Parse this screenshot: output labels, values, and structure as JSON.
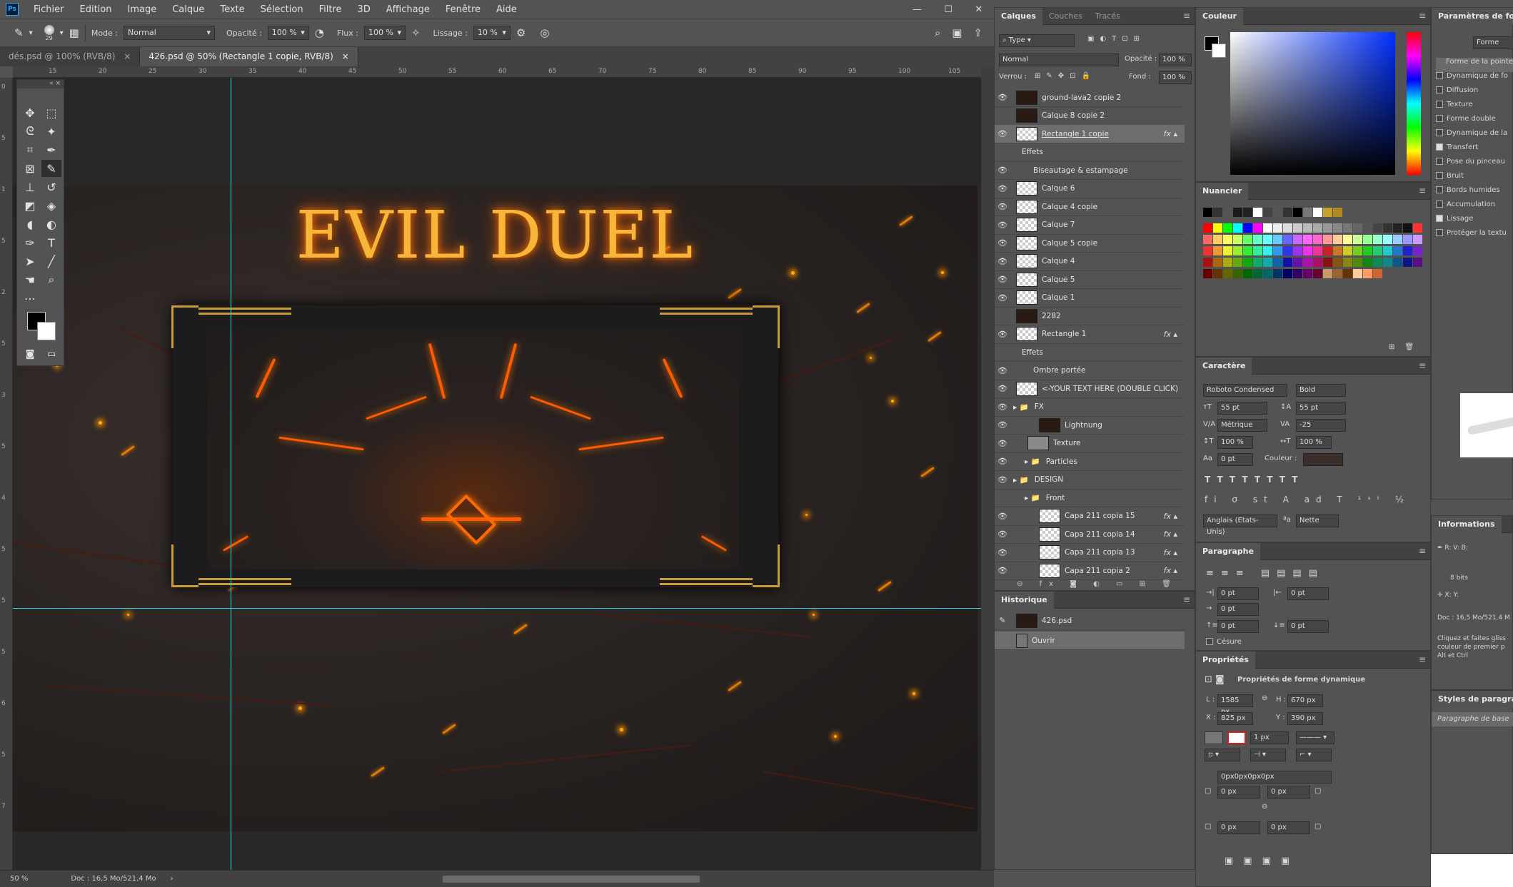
{
  "menu": [
    "Fichier",
    "Edition",
    "Image",
    "Calque",
    "Texte",
    "Sélection",
    "Filtre",
    "3D",
    "Affichage",
    "Fenêtre",
    "Aide"
  ],
  "options": {
    "brush_size": "29",
    "mode_label": "Mode :",
    "mode_value": "Normal",
    "opacity_label": "Opacité :",
    "opacity_value": "100 %",
    "flow_label": "Flux :",
    "flow_value": "100 %",
    "smoothing_label": "Lissage :",
    "smoothing_value": "10 %"
  },
  "doc_tabs": [
    {
      "label": "dés.psd @ 100% (RVB/8)",
      "active": false
    },
    {
      "label": "426.psd @ 50% (Rectangle 1 copie, RVB/8)",
      "active": true
    }
  ],
  "ruler_top": [
    "15",
    "20",
    "25",
    "30",
    "35",
    "40",
    "45",
    "50",
    "55",
    "60",
    "65",
    "70",
    "75",
    "80",
    "85",
    "90",
    "95",
    "100",
    "105"
  ],
  "ruler_left": [
    "0",
    "5",
    "1",
    "5",
    "2",
    "5",
    "3",
    "5",
    "4",
    "5",
    "5",
    "5",
    "6",
    "5",
    "7"
  ],
  "artwork": {
    "title": "EVIL DUEL"
  },
  "status": {
    "zoom": "50 %",
    "doc": "Doc : 16,5 Mo/521,4 Mo"
  },
  "layers_panel": {
    "tabs": [
      "Calques",
      "Couches",
      "Tracés"
    ],
    "filter": "Type",
    "blend": "Normal",
    "opacity_label": "Opacité :",
    "opacity_value": "100 %",
    "lock_label": "Verrou :",
    "fill_label": "Fond :",
    "fill_value": "100 %",
    "layers": [
      {
        "name": "ground-lava2 copie 2",
        "eye": true,
        "thumb": "dark",
        "fx": false,
        "indent": 0
      },
      {
        "name": "Calque 8 copie 2",
        "eye": false,
        "thumb": "dark",
        "fx": false,
        "indent": 0
      },
      {
        "name": "Rectangle 1 copie",
        "eye": true,
        "thumb": "shape",
        "fx": true,
        "indent": 0,
        "sel": true
      },
      {
        "name": "Effets",
        "eye": false,
        "thumb": "none",
        "fx": false,
        "indent": 1
      },
      {
        "name": "Biseautage & estampage",
        "eye": true,
        "thumb": "none",
        "fx": false,
        "indent": 2
      },
      {
        "name": "Calque 6",
        "eye": true,
        "thumb": "trans",
        "fx": false,
        "indent": 0
      },
      {
        "name": "Calque 4 copie",
        "eye": true,
        "thumb": "trans",
        "fx": false,
        "indent": 0
      },
      {
        "name": "Calque 7",
        "eye": true,
        "thumb": "trans",
        "fx": false,
        "indent": 0
      },
      {
        "name": "Calque 5 copie",
        "eye": true,
        "thumb": "trans",
        "fx": false,
        "indent": 0
      },
      {
        "name": "Calque 4",
        "eye": true,
        "thumb": "trans",
        "fx": false,
        "indent": 0
      },
      {
        "name": "Calque 5",
        "eye": true,
        "thumb": "trans",
        "fx": false,
        "indent": 0
      },
      {
        "name": "Calque 1",
        "eye": true,
        "thumb": "trans",
        "fx": false,
        "indent": 0
      },
      {
        "name": "2282",
        "eye": false,
        "thumb": "dark",
        "fx": false,
        "indent": 0
      },
      {
        "name": "Rectangle 1",
        "eye": true,
        "thumb": "shape",
        "fx": true,
        "indent": 0
      },
      {
        "name": "Effets",
        "eye": false,
        "thumb": "none",
        "fx": false,
        "indent": 1
      },
      {
        "name": "Ombre portée",
        "eye": true,
        "thumb": "none",
        "fx": false,
        "indent": 2
      },
      {
        "name": "<-YOUR TEXT HERE (DOUBLE CLICK)",
        "eye": true,
        "thumb": "shape",
        "fx": false,
        "indent": 0
      },
      {
        "name": "FX",
        "eye": true,
        "thumb": "folder",
        "fx": false,
        "indent": 0
      },
      {
        "name": "Lightnung",
        "eye": true,
        "thumb": "dark",
        "fx": false,
        "indent": 2
      },
      {
        "name": "Texture",
        "eye": true,
        "thumb": "grey",
        "fx": false,
        "indent": 1
      },
      {
        "name": "Particles",
        "eye": true,
        "thumb": "folder",
        "fx": false,
        "indent": 1
      },
      {
        "name": "DESIGN",
        "eye": true,
        "thumb": "folder",
        "fx": false,
        "indent": 0
      },
      {
        "name": "Front",
        "eye": false,
        "thumb": "folder",
        "fx": false,
        "indent": 1
      },
      {
        "name": "Capa 211 copia 15",
        "eye": true,
        "thumb": "trans",
        "fx": true,
        "indent": 2
      },
      {
        "name": "Capa 211 copia 14",
        "eye": true,
        "thumb": "trans",
        "fx": true,
        "indent": 2
      },
      {
        "name": "Capa 211 copia 13",
        "eye": true,
        "thumb": "trans",
        "fx": true,
        "indent": 2
      },
      {
        "name": "Capa 211 copia 2",
        "eye": true,
        "thumb": "trans",
        "fx": true,
        "indent": 2
      }
    ]
  },
  "history": {
    "tab": "Historique",
    "items": [
      "426.psd",
      "Ouvrir"
    ]
  },
  "color_panel": {
    "tab": "Couleur"
  },
  "swatches_panel": {
    "tab": "Nuancier"
  },
  "character": {
    "tab": "Caractère",
    "font": "Roboto Condensed",
    "style": "Bold",
    "size": "55 pt",
    "leading": "55 pt",
    "kerning": "Métrique",
    "tracking": "-25",
    "vscale": "100 %",
    "hscale": "100 %",
    "baseline": "0 pt",
    "color_label": "Couleur :",
    "language": "Anglais (Etats-Unis)",
    "aa": "Nette"
  },
  "paragraph": {
    "tab": "Paragraphe",
    "indent_left": "0 pt",
    "indent_right": "0 pt",
    "indent_first": "0 pt",
    "space_before": "0 pt",
    "space_after": "0 pt",
    "hyphen": "Césure"
  },
  "properties": {
    "tab": "Propriétés",
    "title": "Propriétés de forme dynamique",
    "W": "1585 px",
    "H": "670 px",
    "X": "825 px",
    "Y": "390 px",
    "stroke": "1 px",
    "radii": "0px0px0px0px",
    "r1": "0 px",
    "r2": "0 px",
    "r3": "0 px",
    "r4": "0 px"
  },
  "brush_settings": {
    "tab": "Paramètres de forme",
    "preset_btn": "Forme",
    "items": [
      {
        "label": "Forme de la pointe",
        "checked": null
      },
      {
        "label": "Dynamique de fo",
        "checked": false
      },
      {
        "label": "Diffusion",
        "checked": false
      },
      {
        "label": "Texture",
        "checked": false
      },
      {
        "label": "Forme double",
        "checked": false
      },
      {
        "label": "Dynamique de la",
        "checked": false
      },
      {
        "label": "Transfert",
        "checked": true
      },
      {
        "label": "Pose du pinceau",
        "checked": false
      },
      {
        "label": "Bruit",
        "checked": false
      },
      {
        "label": "Bords humides",
        "checked": false
      },
      {
        "label": "Accumulation",
        "checked": false
      },
      {
        "label": "Lissage",
        "checked": true
      },
      {
        "label": "Protéger la textu",
        "checked": false
      }
    ]
  },
  "info_panel": {
    "tab": "Informations",
    "bits": "8 bits",
    "doc": "Doc : 16,5 Mo/521,4 M",
    "hint": "Cliquez et faites gliss couleur de premier p Alt et Ctrl"
  },
  "para_styles": {
    "tab": "Styles de paragraphe",
    "item": "Paragraphe de base"
  }
}
